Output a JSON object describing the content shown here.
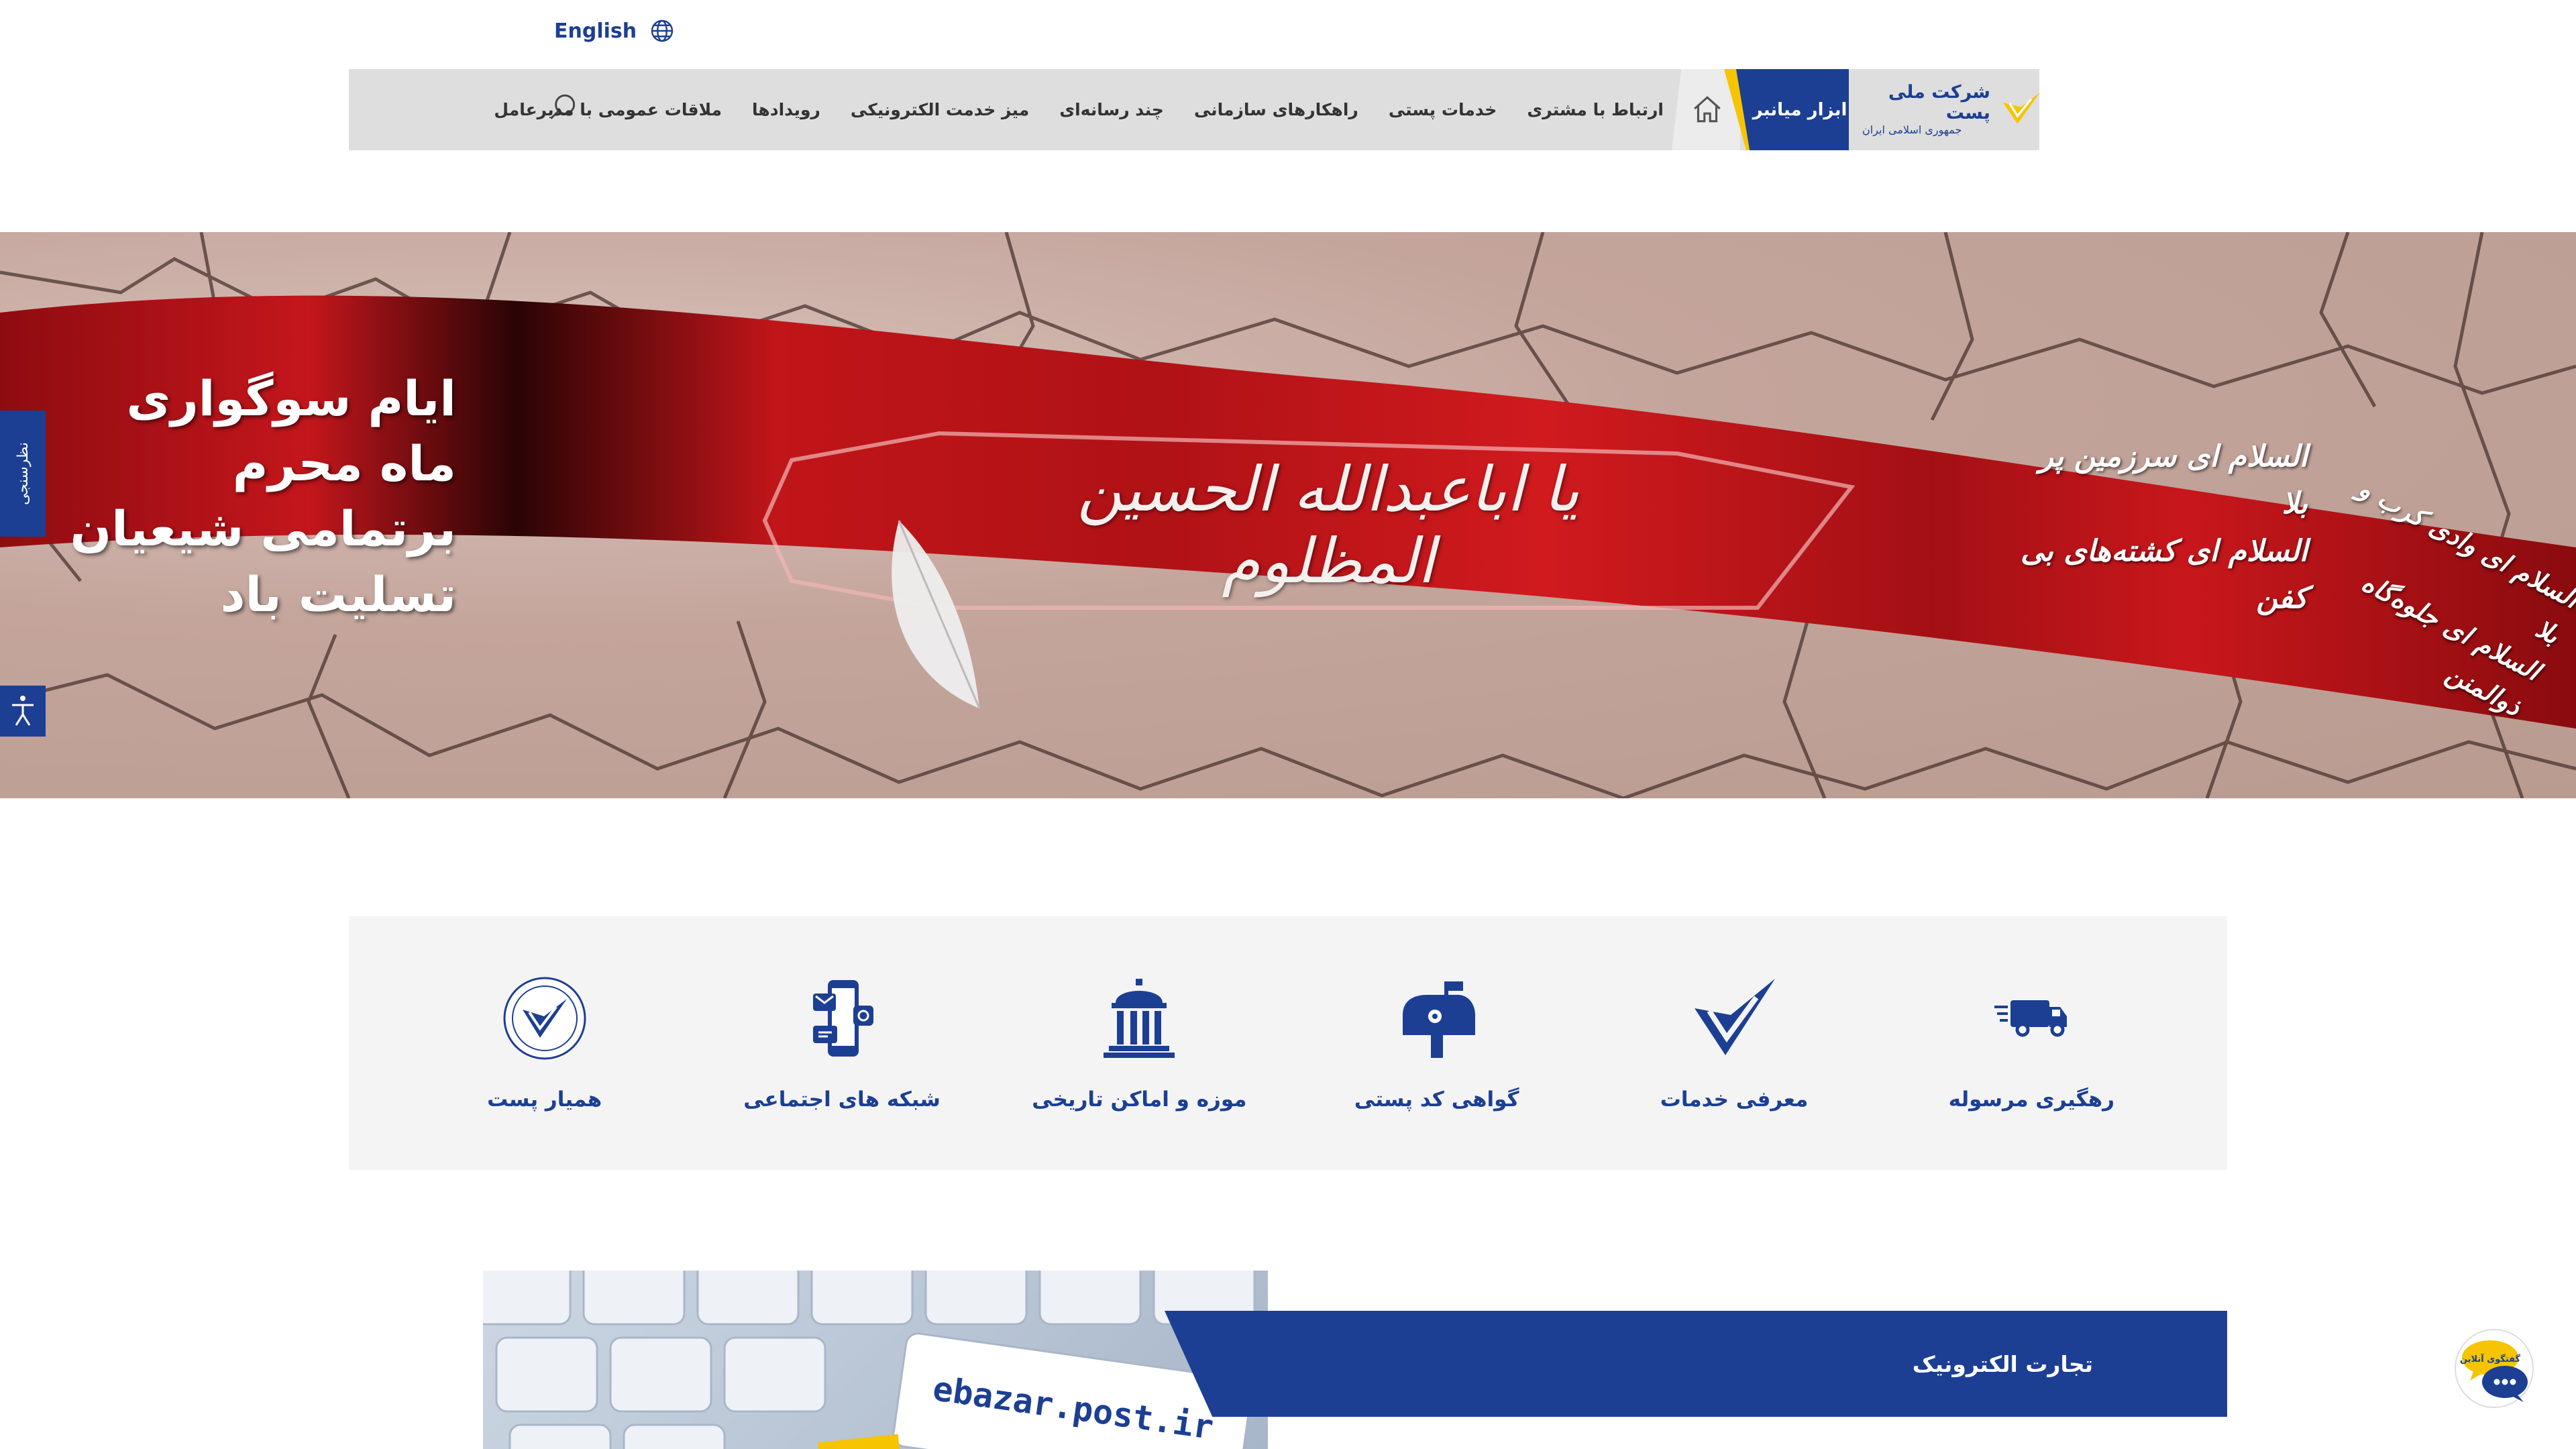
{
  "header": {
    "language_link": "English",
    "tools_button": "ابزار میانبر",
    "logo_title": "شرکت ملی پست",
    "logo_subtitle": "جمهوری اسلامی ایران",
    "nav_items": [
      "ارتباط با مشتری",
      "خدمات پستی",
      "راهکارهای سازمانی",
      "چند رسانه‌ای",
      "میز خدمت الکترونیکی",
      "رویدادها",
      "ملاقات عمومی با مدیرعامل"
    ]
  },
  "hero": {
    "left_line1": "ایام سوگواری ماه محرم",
    "left_line2": "برتمامی شیعیان تسلیت باد",
    "right_line1": "السلام ای سرزمین پر بلا",
    "right_line2": "السلام ای کشته‌های بی کفن",
    "far_line1": "السلام ای وادی کرب و بلا",
    "far_line2": "السلام ای جلوه‌گاه ذوالمنن",
    "calligraphy": "یا اباعبدالله الحسین المظلوم"
  },
  "side_tabs": {
    "survey": "نظرسنجی"
  },
  "services": [
    {
      "label": "رهگیری مرسوله",
      "icon": "delivery-truck-icon"
    },
    {
      "label": "معرفی خدمات",
      "icon": "post-logo-icon"
    },
    {
      "label": "گواهی کد پستی",
      "icon": "mailbox-icon"
    },
    {
      "label": "موزه و اماکن تاریخی",
      "icon": "museum-icon"
    },
    {
      "label": "شبکه های اجتماعی",
      "icon": "social-network-icon"
    },
    {
      "label": "همیار پست",
      "icon": "hamyar-post-icon"
    }
  ],
  "ecommerce": {
    "title": "تجارت الکترونیک",
    "image_text": "ebazar.post.ir"
  },
  "chat": {
    "label": "گفتگوی آنلاین"
  },
  "colors": {
    "brand_blue": "#1c3f93",
    "brand_yellow": "#f6c400",
    "nav_gray": "#dedede",
    "services_bg": "#f4f4f4"
  }
}
